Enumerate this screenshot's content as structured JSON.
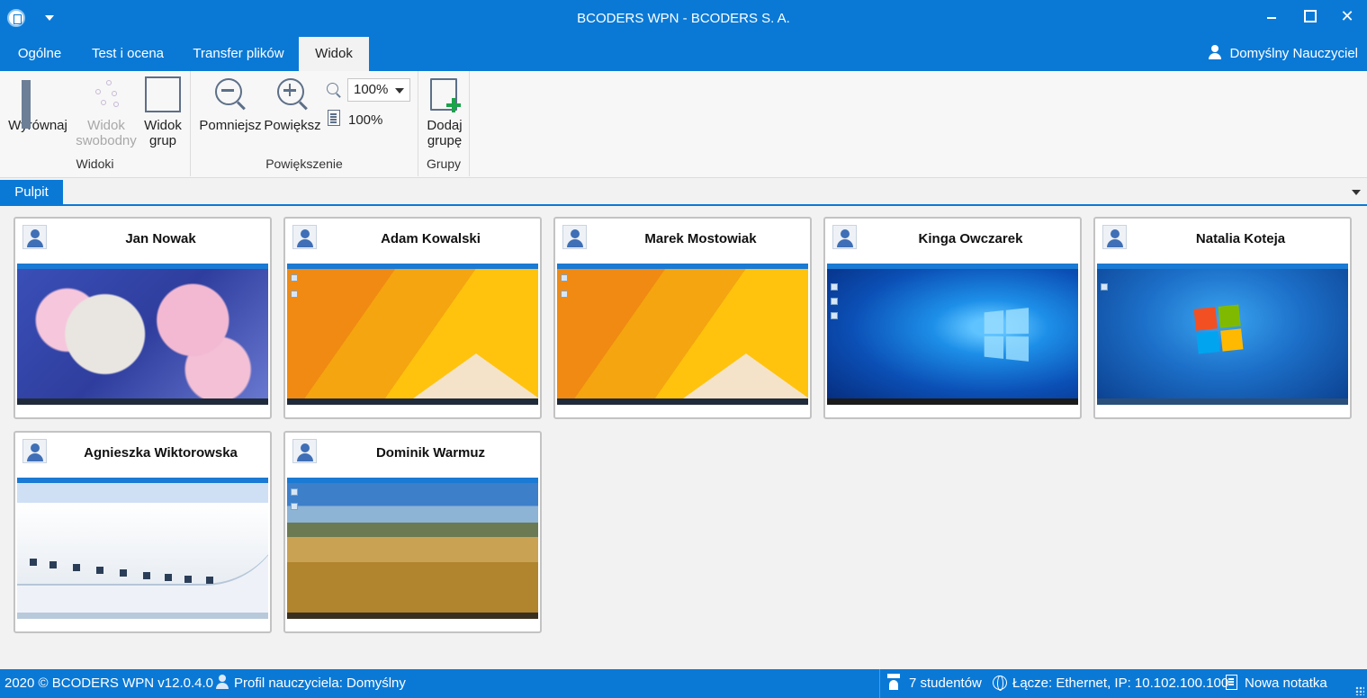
{
  "window": {
    "title": "BCODERS WPN - BCODERS S. A.",
    "minimize": "",
    "maximize": "",
    "close": "✕"
  },
  "tabs": [
    {
      "label": "Ogólne"
    },
    {
      "label": "Test i ocena"
    },
    {
      "label": "Transfer plików"
    },
    {
      "label": "Widok"
    }
  ],
  "active_tab": "Widok",
  "user": {
    "name": "Domyślny Nauczyciel"
  },
  "ribbon": {
    "groups": {
      "widoki": {
        "label": "Widoki",
        "buttons": {
          "wyrownaj": "Wyrównaj",
          "widok_swobodny_1": "Widok",
          "widok_swobodny_2": "swobodny",
          "widok_grup_1": "Widok",
          "widok_grup_2": "grup"
        }
      },
      "powiekszenie": {
        "label": "Powiększenie",
        "pomniejsz": "Pomniejsz",
        "powieksz": "Powiększ",
        "zoom_value": "100%",
        "page_value": "100%"
      },
      "grupy": {
        "label": "Grupy",
        "dodaj_1": "Dodaj",
        "dodaj_2": "grupę"
      }
    }
  },
  "document_tab": {
    "label": "Pulpit"
  },
  "students": [
    {
      "name": "Jan Nowak",
      "wallpaper": "anime"
    },
    {
      "name": "Adam Kowalski",
      "wallpaper": "windows-8"
    },
    {
      "name": "Marek Mostowiak",
      "wallpaper": "windows-8"
    },
    {
      "name": "Kinga Owczarek",
      "wallpaper": "windows-10"
    },
    {
      "name": "Natalia Koteja",
      "wallpaper": "windows-7"
    },
    {
      "name": "Agnieszka Wiktorowska",
      "wallpaper": "architecture"
    },
    {
      "name": "Dominik Warmuz",
      "wallpaper": "field"
    }
  ],
  "status": {
    "copyright": "2020 ©  BCODERS WPN v12.0.4.0",
    "profile": "Profil nauczyciela: Domyślny",
    "students_count": "7 studentów",
    "connection": "Łącze: Ethernet, IP: 10.102.100.100",
    "note": "Nowa notatka"
  },
  "colors": {
    "accent": "#0a79d6",
    "background": "#f2f2f2",
    "add_green": "#1aa34a"
  }
}
